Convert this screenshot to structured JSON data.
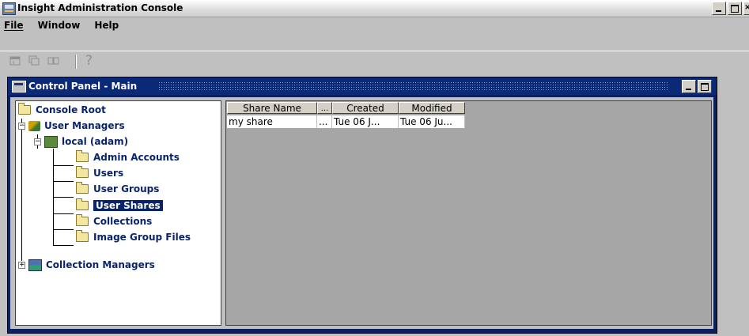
{
  "app": {
    "title": "Insight Administration Console"
  },
  "menu": [
    {
      "label": "File"
    },
    {
      "label": "Window"
    },
    {
      "label": "Help"
    }
  ],
  "toolbar": {
    "buttons": [
      "new-window-icon",
      "cascade-icon",
      "tile-icon",
      "help-icon"
    ],
    "help_glyph": "?"
  },
  "panel": {
    "title": "Control Panel - Main"
  },
  "tree": {
    "root": "Console Root",
    "user_managers": "User Managers",
    "local": "local (adam)",
    "children": [
      "Admin Accounts",
      "Users",
      "User Groups",
      "User Shares",
      "Collections",
      "Image Group Files"
    ],
    "selected": "User Shares",
    "collection_managers": "Collection Managers"
  },
  "table": {
    "columns": [
      "Share Name",
      "...",
      "Created",
      "Modified"
    ],
    "rows": [
      [
        "my share",
        "...",
        "Tue 06 J...",
        "Tue 06 Ju..."
      ]
    ]
  },
  "colors": {
    "panel_title_bg": "#0a2a78",
    "selection": "#0a246a",
    "table_bg": "#a6a6a6"
  }
}
